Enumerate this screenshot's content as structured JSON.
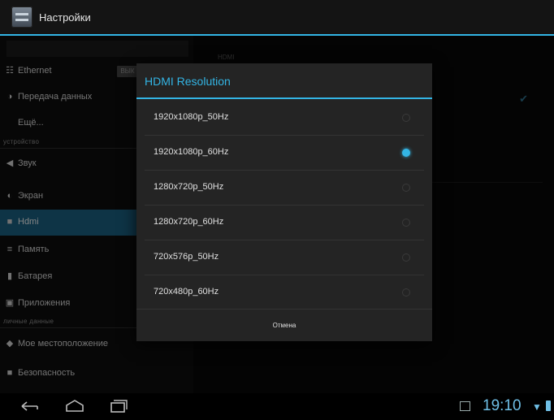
{
  "actionbar": {
    "title": "Настройки",
    "icon": "settings-icon"
  },
  "sidebar": {
    "items": [
      {
        "key": "ethernet",
        "label": "Ethernet",
        "icon": "ethernet-icon",
        "toggle": "ВЫК"
      },
      {
        "key": "data",
        "label": "Передача данных",
        "icon": "data-usage-icon"
      },
      {
        "key": "more",
        "label": "Ещё...",
        "icon": ""
      }
    ],
    "header_device": "УСТРОЙСТВО",
    "device_items": [
      {
        "key": "sound",
        "label": "Звук",
        "icon": "speaker-icon"
      },
      {
        "key": "screen",
        "label": "Экран",
        "icon": "brightness-icon"
      },
      {
        "key": "hdmi",
        "label": "Hdmi",
        "icon": "hdmi-icon"
      },
      {
        "key": "memory",
        "label": "Память",
        "icon": "storage-icon"
      },
      {
        "key": "battery",
        "label": "Батарея",
        "icon": "battery-icon"
      },
      {
        "key": "apps",
        "label": "Приложения",
        "icon": "apps-icon"
      }
    ],
    "header_personal": "ЛИЧНЫЕ ДАННЫЕ",
    "personal_items": [
      {
        "key": "location",
        "label": "Мое местоположение",
        "icon": "location-icon"
      },
      {
        "key": "security",
        "label": "Безопасность",
        "icon": "lock-icon"
      }
    ]
  },
  "pane": {
    "header": "HDMI"
  },
  "dialog": {
    "title": "HDMI Resolution",
    "options": [
      {
        "label": "1920x1080p_50Hz",
        "selected": false
      },
      {
        "label": "1920x1080p_60Hz",
        "selected": true
      },
      {
        "label": "1280x720p_50Hz",
        "selected": false
      },
      {
        "label": "1280x720p_60Hz",
        "selected": false
      },
      {
        "label": "720x576p_50Hz",
        "selected": false
      },
      {
        "label": "720x480p_60Hz",
        "selected": false
      }
    ],
    "cancel_label": "Отмена"
  },
  "statusbar": {
    "time": "19:10"
  },
  "colors": {
    "accent": "#33b5e5",
    "active_item": "#1a5f80",
    "dialog_bg": "#242424"
  }
}
